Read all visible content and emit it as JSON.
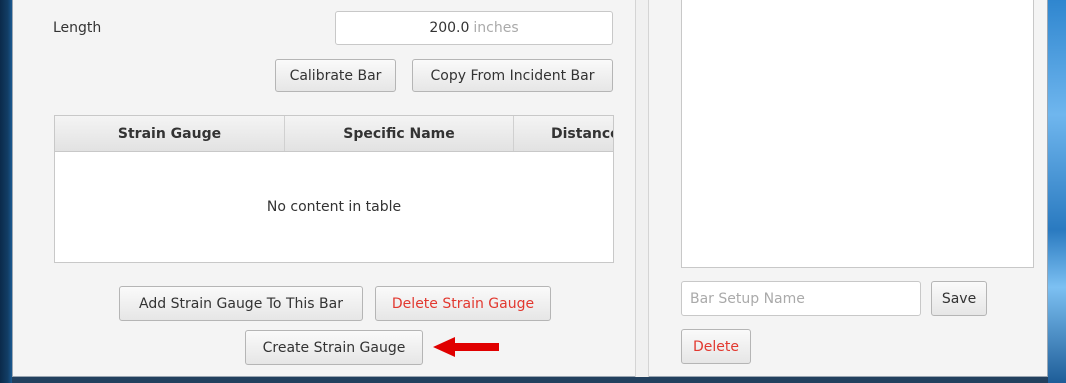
{
  "bar_form": {
    "length_label": "Length",
    "length_value": "200.0",
    "length_unit": "inches",
    "calibrate_button": "Calibrate Bar",
    "copy_button": "Copy From Incident Bar"
  },
  "strain_table": {
    "columns": [
      "Strain Gauge",
      "Specific Name",
      "Distance"
    ],
    "empty_text": "No content in table"
  },
  "strain_actions": {
    "add_button": "Add Strain Gauge To This Bar",
    "delete_button": "Delete Strain Gauge",
    "create_button": "Create Strain Gauge"
  },
  "bar_setup": {
    "name_placeholder": "Bar Setup Name",
    "save_button": "Save",
    "delete_button": "Delete"
  },
  "colors": {
    "danger": "#e2382f",
    "arrow": "#e00000"
  }
}
